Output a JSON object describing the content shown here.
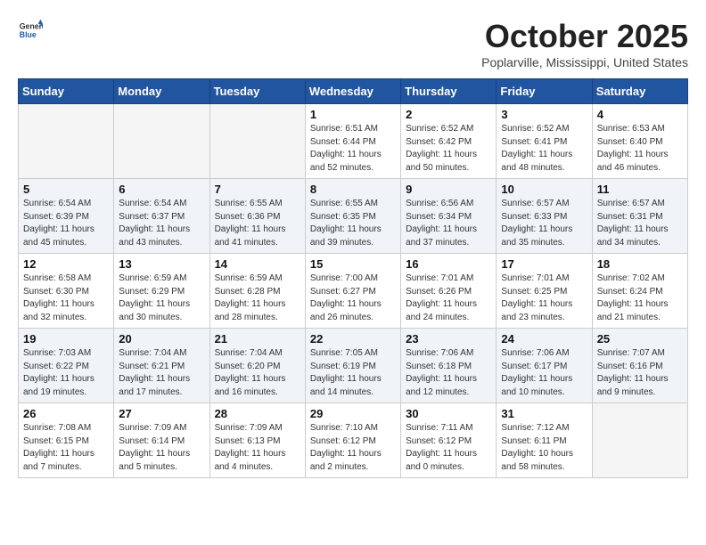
{
  "header": {
    "logo_general": "General",
    "logo_blue": "Blue",
    "month_year": "October 2025",
    "location": "Poplarville, Mississippi, United States"
  },
  "weekdays": [
    "Sunday",
    "Monday",
    "Tuesday",
    "Wednesday",
    "Thursday",
    "Friday",
    "Saturday"
  ],
  "weeks": [
    [
      {
        "day": "",
        "empty": true
      },
      {
        "day": "",
        "empty": true
      },
      {
        "day": "",
        "empty": true
      },
      {
        "day": "1",
        "sunrise": "6:51 AM",
        "sunset": "6:44 PM",
        "daylight": "11 hours and 52 minutes."
      },
      {
        "day": "2",
        "sunrise": "6:52 AM",
        "sunset": "6:42 PM",
        "daylight": "11 hours and 50 minutes."
      },
      {
        "day": "3",
        "sunrise": "6:52 AM",
        "sunset": "6:41 PM",
        "daylight": "11 hours and 48 minutes."
      },
      {
        "day": "4",
        "sunrise": "6:53 AM",
        "sunset": "6:40 PM",
        "daylight": "11 hours and 46 minutes."
      }
    ],
    [
      {
        "day": "5",
        "sunrise": "6:54 AM",
        "sunset": "6:39 PM",
        "daylight": "11 hours and 45 minutes."
      },
      {
        "day": "6",
        "sunrise": "6:54 AM",
        "sunset": "6:37 PM",
        "daylight": "11 hours and 43 minutes."
      },
      {
        "day": "7",
        "sunrise": "6:55 AM",
        "sunset": "6:36 PM",
        "daylight": "11 hours and 41 minutes."
      },
      {
        "day": "8",
        "sunrise": "6:55 AM",
        "sunset": "6:35 PM",
        "daylight": "11 hours and 39 minutes."
      },
      {
        "day": "9",
        "sunrise": "6:56 AM",
        "sunset": "6:34 PM",
        "daylight": "11 hours and 37 minutes."
      },
      {
        "day": "10",
        "sunrise": "6:57 AM",
        "sunset": "6:33 PM",
        "daylight": "11 hours and 35 minutes."
      },
      {
        "day": "11",
        "sunrise": "6:57 AM",
        "sunset": "6:31 PM",
        "daylight": "11 hours and 34 minutes."
      }
    ],
    [
      {
        "day": "12",
        "sunrise": "6:58 AM",
        "sunset": "6:30 PM",
        "daylight": "11 hours and 32 minutes."
      },
      {
        "day": "13",
        "sunrise": "6:59 AM",
        "sunset": "6:29 PM",
        "daylight": "11 hours and 30 minutes."
      },
      {
        "day": "14",
        "sunrise": "6:59 AM",
        "sunset": "6:28 PM",
        "daylight": "11 hours and 28 minutes."
      },
      {
        "day": "15",
        "sunrise": "7:00 AM",
        "sunset": "6:27 PM",
        "daylight": "11 hours and 26 minutes."
      },
      {
        "day": "16",
        "sunrise": "7:01 AM",
        "sunset": "6:26 PM",
        "daylight": "11 hours and 24 minutes."
      },
      {
        "day": "17",
        "sunrise": "7:01 AM",
        "sunset": "6:25 PM",
        "daylight": "11 hours and 23 minutes."
      },
      {
        "day": "18",
        "sunrise": "7:02 AM",
        "sunset": "6:24 PM",
        "daylight": "11 hours and 21 minutes."
      }
    ],
    [
      {
        "day": "19",
        "sunrise": "7:03 AM",
        "sunset": "6:22 PM",
        "daylight": "11 hours and 19 minutes."
      },
      {
        "day": "20",
        "sunrise": "7:04 AM",
        "sunset": "6:21 PM",
        "daylight": "11 hours and 17 minutes."
      },
      {
        "day": "21",
        "sunrise": "7:04 AM",
        "sunset": "6:20 PM",
        "daylight": "11 hours and 16 minutes."
      },
      {
        "day": "22",
        "sunrise": "7:05 AM",
        "sunset": "6:19 PM",
        "daylight": "11 hours and 14 minutes."
      },
      {
        "day": "23",
        "sunrise": "7:06 AM",
        "sunset": "6:18 PM",
        "daylight": "11 hours and 12 minutes."
      },
      {
        "day": "24",
        "sunrise": "7:06 AM",
        "sunset": "6:17 PM",
        "daylight": "11 hours and 10 minutes."
      },
      {
        "day": "25",
        "sunrise": "7:07 AM",
        "sunset": "6:16 PM",
        "daylight": "11 hours and 9 minutes."
      }
    ],
    [
      {
        "day": "26",
        "sunrise": "7:08 AM",
        "sunset": "6:15 PM",
        "daylight": "11 hours and 7 minutes."
      },
      {
        "day": "27",
        "sunrise": "7:09 AM",
        "sunset": "6:14 PM",
        "daylight": "11 hours and 5 minutes."
      },
      {
        "day": "28",
        "sunrise": "7:09 AM",
        "sunset": "6:13 PM",
        "daylight": "11 hours and 4 minutes."
      },
      {
        "day": "29",
        "sunrise": "7:10 AM",
        "sunset": "6:12 PM",
        "daylight": "11 hours and 2 minutes."
      },
      {
        "day": "30",
        "sunrise": "7:11 AM",
        "sunset": "6:12 PM",
        "daylight": "11 hours and 0 minutes."
      },
      {
        "day": "31",
        "sunrise": "7:12 AM",
        "sunset": "6:11 PM",
        "daylight": "10 hours and 58 minutes."
      },
      {
        "day": "",
        "empty": true
      }
    ]
  ]
}
